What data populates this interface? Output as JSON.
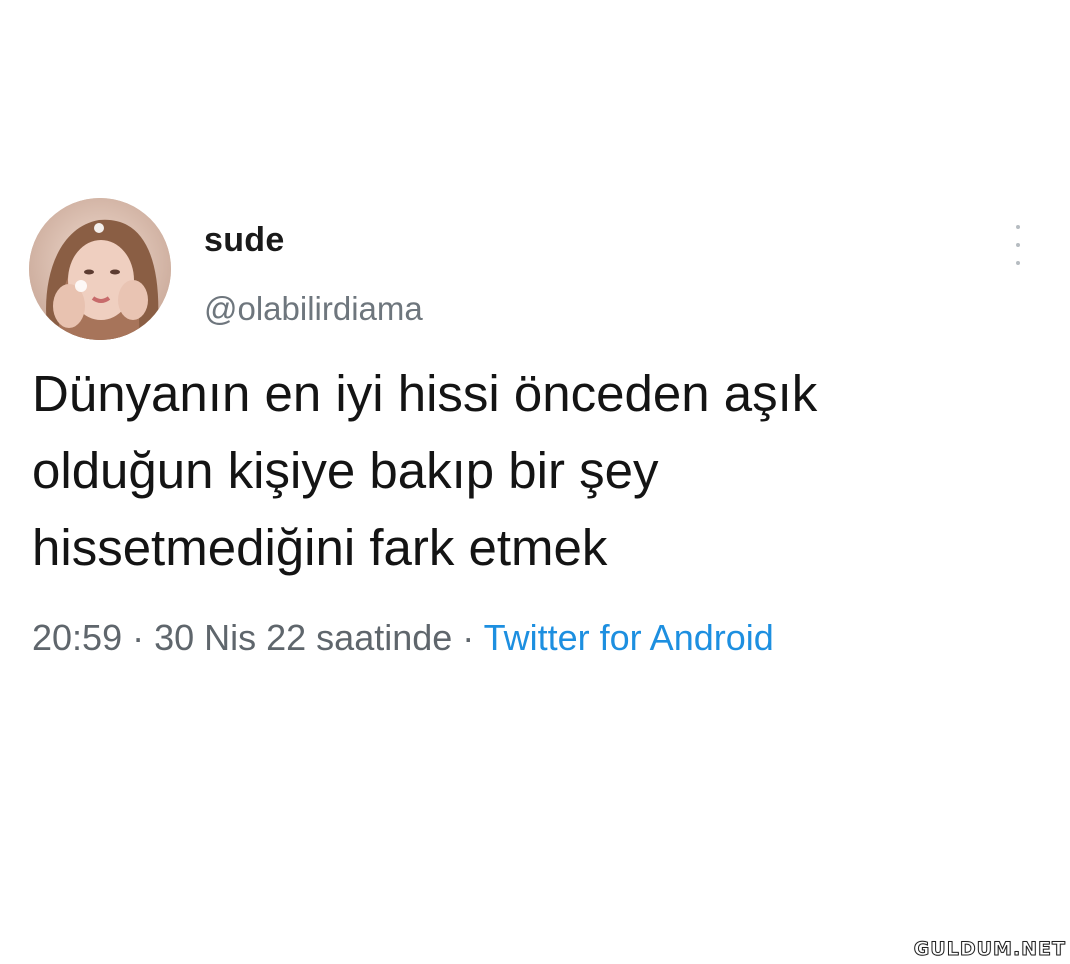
{
  "tweet": {
    "display_name": "sude",
    "handle": "@olabilirdiama",
    "text_lines": [
      "Dünyanın en iyi hissi önceden aşık",
      "olduğun kişiye bakıp bir şey",
      "hissetmediğini fark etmek"
    ],
    "time": "20:59",
    "separator": " · ",
    "date": "30 Nis 22 saatinde",
    "source": "Twitter for Android"
  },
  "icons": {
    "more": "vertical-ellipsis-icon",
    "avatar": "profile-photo"
  },
  "colors": {
    "text": "#141414",
    "secondary": "#5f666c",
    "link": "#1d8fe0",
    "background": "#ffffff"
  },
  "watermark": "GULDUM.NET"
}
